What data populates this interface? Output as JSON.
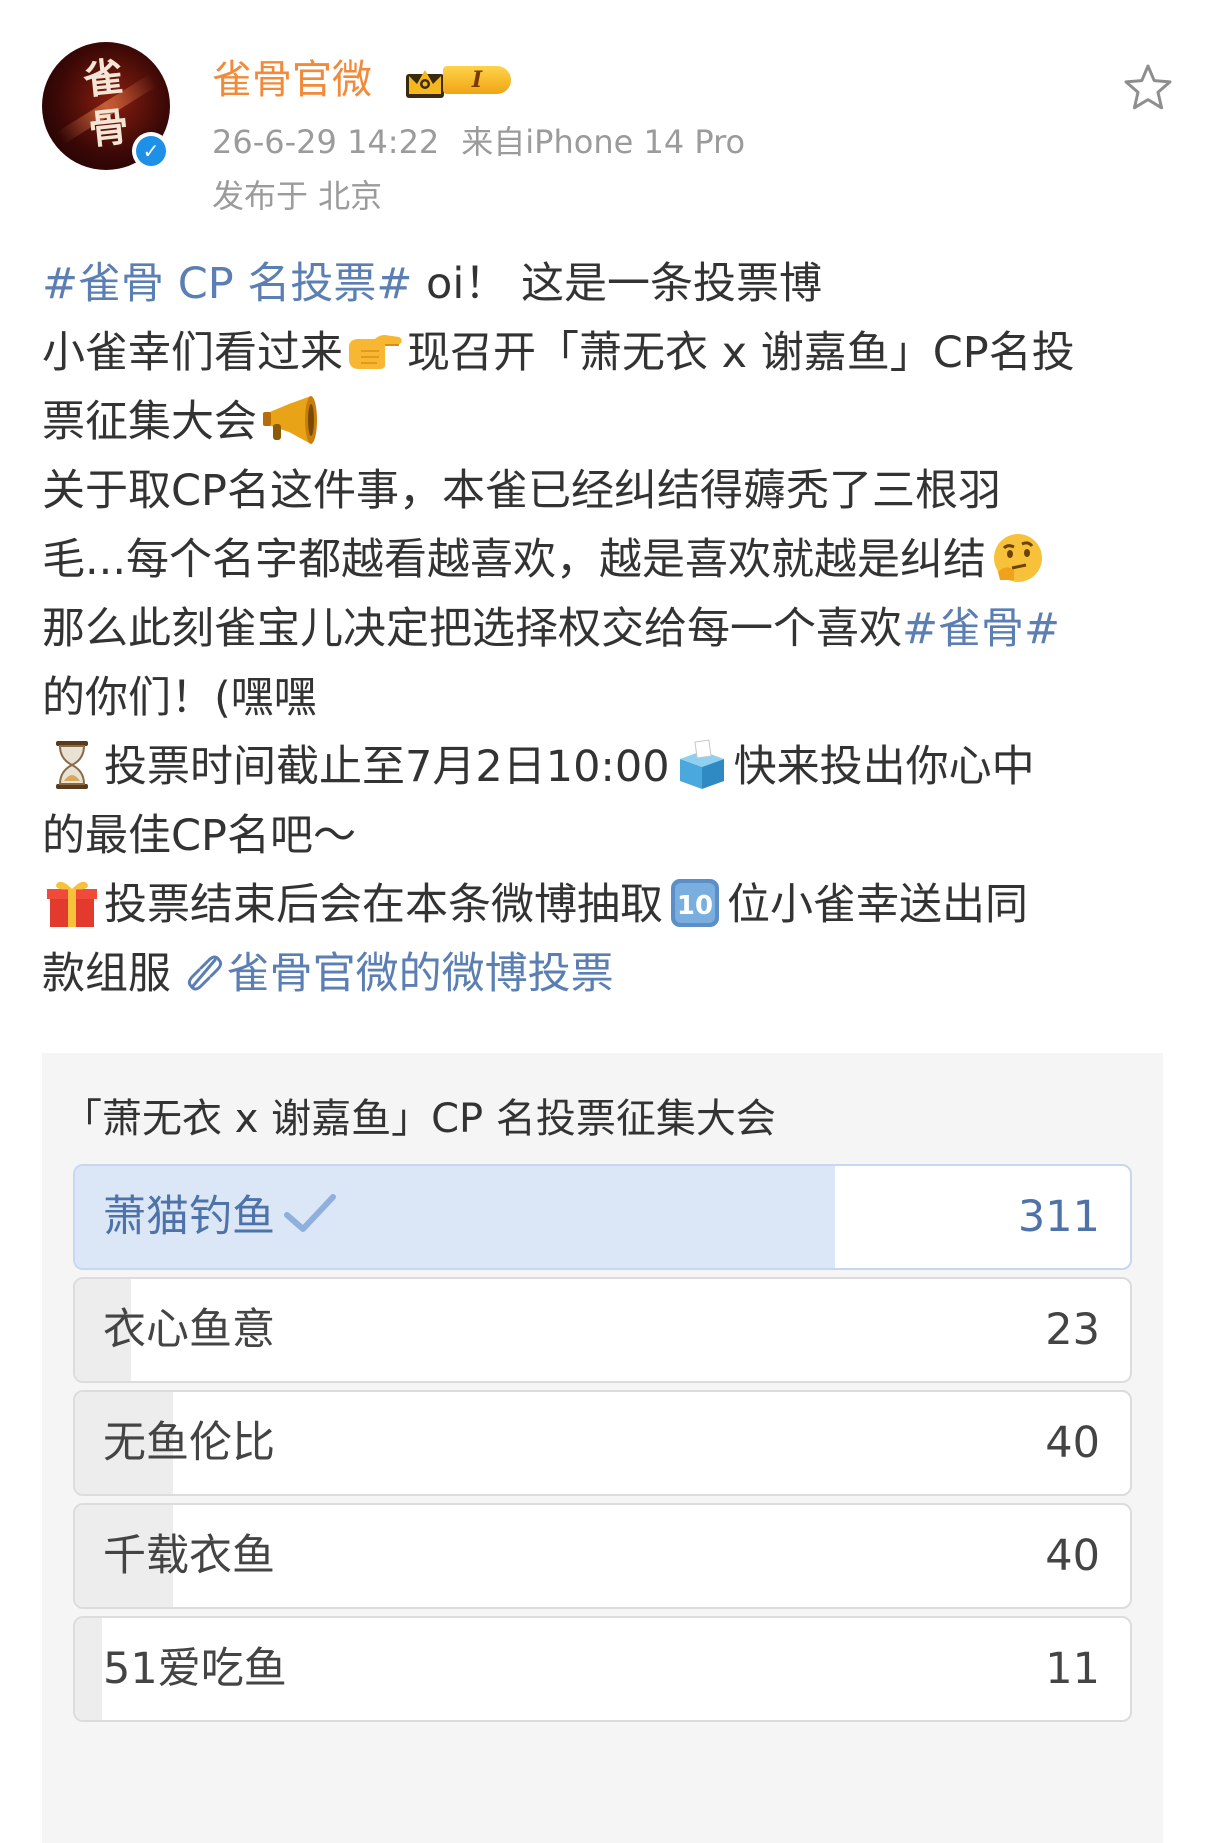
{
  "header": {
    "username": "雀骨官微",
    "vip_level": "I",
    "timestamp": "26-6-29 14:22",
    "source": "来自iPhone 14 Pro",
    "location": "发布于 北京",
    "avatar_text": "雀骨"
  },
  "post": {
    "l1_topic": "#雀骨 CP 名投票#",
    "l1_text": " oi！ 这是一条投票博",
    "l2_a": "小雀幸们看过来",
    "l2_b": "现召开「萧无衣 x 谢嘉鱼」CP名投",
    "l3_a": "票征集大会",
    "l4": "关于取CP名这件事，本雀已经纠结得薅秃了三根羽",
    "l5_a": "毛...每个名字都越看越喜欢，越是喜欢就越是纠结",
    "l6_a": "那么此刻雀宝儿决定把选择权交给每一个喜欢",
    "l6_topic": "#雀骨#",
    "l7": "的你们！(嘿嘿",
    "l8_a": "投票时间截止至7月2日10:00",
    "l8_b": "快来投出你心中",
    "l9": "的最佳CP名吧～",
    "l10_a": "投票结束后会在本条微博抽取",
    "l10_b": "位小雀幸送出同",
    "l11_a": "款组服 ",
    "l11_link": "雀骨官微的微博投票",
    "emoji_icons": [
      "point-right-emoji",
      "megaphone-emoji",
      "thinking-face-emoji",
      "hourglass-emoji",
      "ballot-box-emoji",
      "gift-emoji",
      "keycap-ten-emoji"
    ]
  },
  "poll": {
    "title": "「萧无衣 x 谢嘉鱼」CP 名投票征集大会",
    "total_votes_note": "",
    "options": [
      {
        "label": "萧猫钓鱼",
        "count": "311",
        "votes": 311,
        "selected": true
      },
      {
        "label": "衣心鱼意",
        "count": "23",
        "votes": 23,
        "selected": false
      },
      {
        "label": "无鱼伦比",
        "count": "40",
        "votes": 40,
        "selected": false
      },
      {
        "label": "千载衣鱼",
        "count": "40",
        "votes": 40,
        "selected": false
      },
      {
        "label": "51爱吃鱼",
        "count": "11",
        "votes": 11,
        "selected": false
      }
    ]
  },
  "colors": {
    "username": "#f28a3a",
    "topic_link": "#5b7fb3",
    "meta_gray": "#9b9b9b",
    "selected_fill": "#dbe6f6",
    "unselected_fill": "#ededed",
    "verified_blue": "#1e90e8"
  }
}
